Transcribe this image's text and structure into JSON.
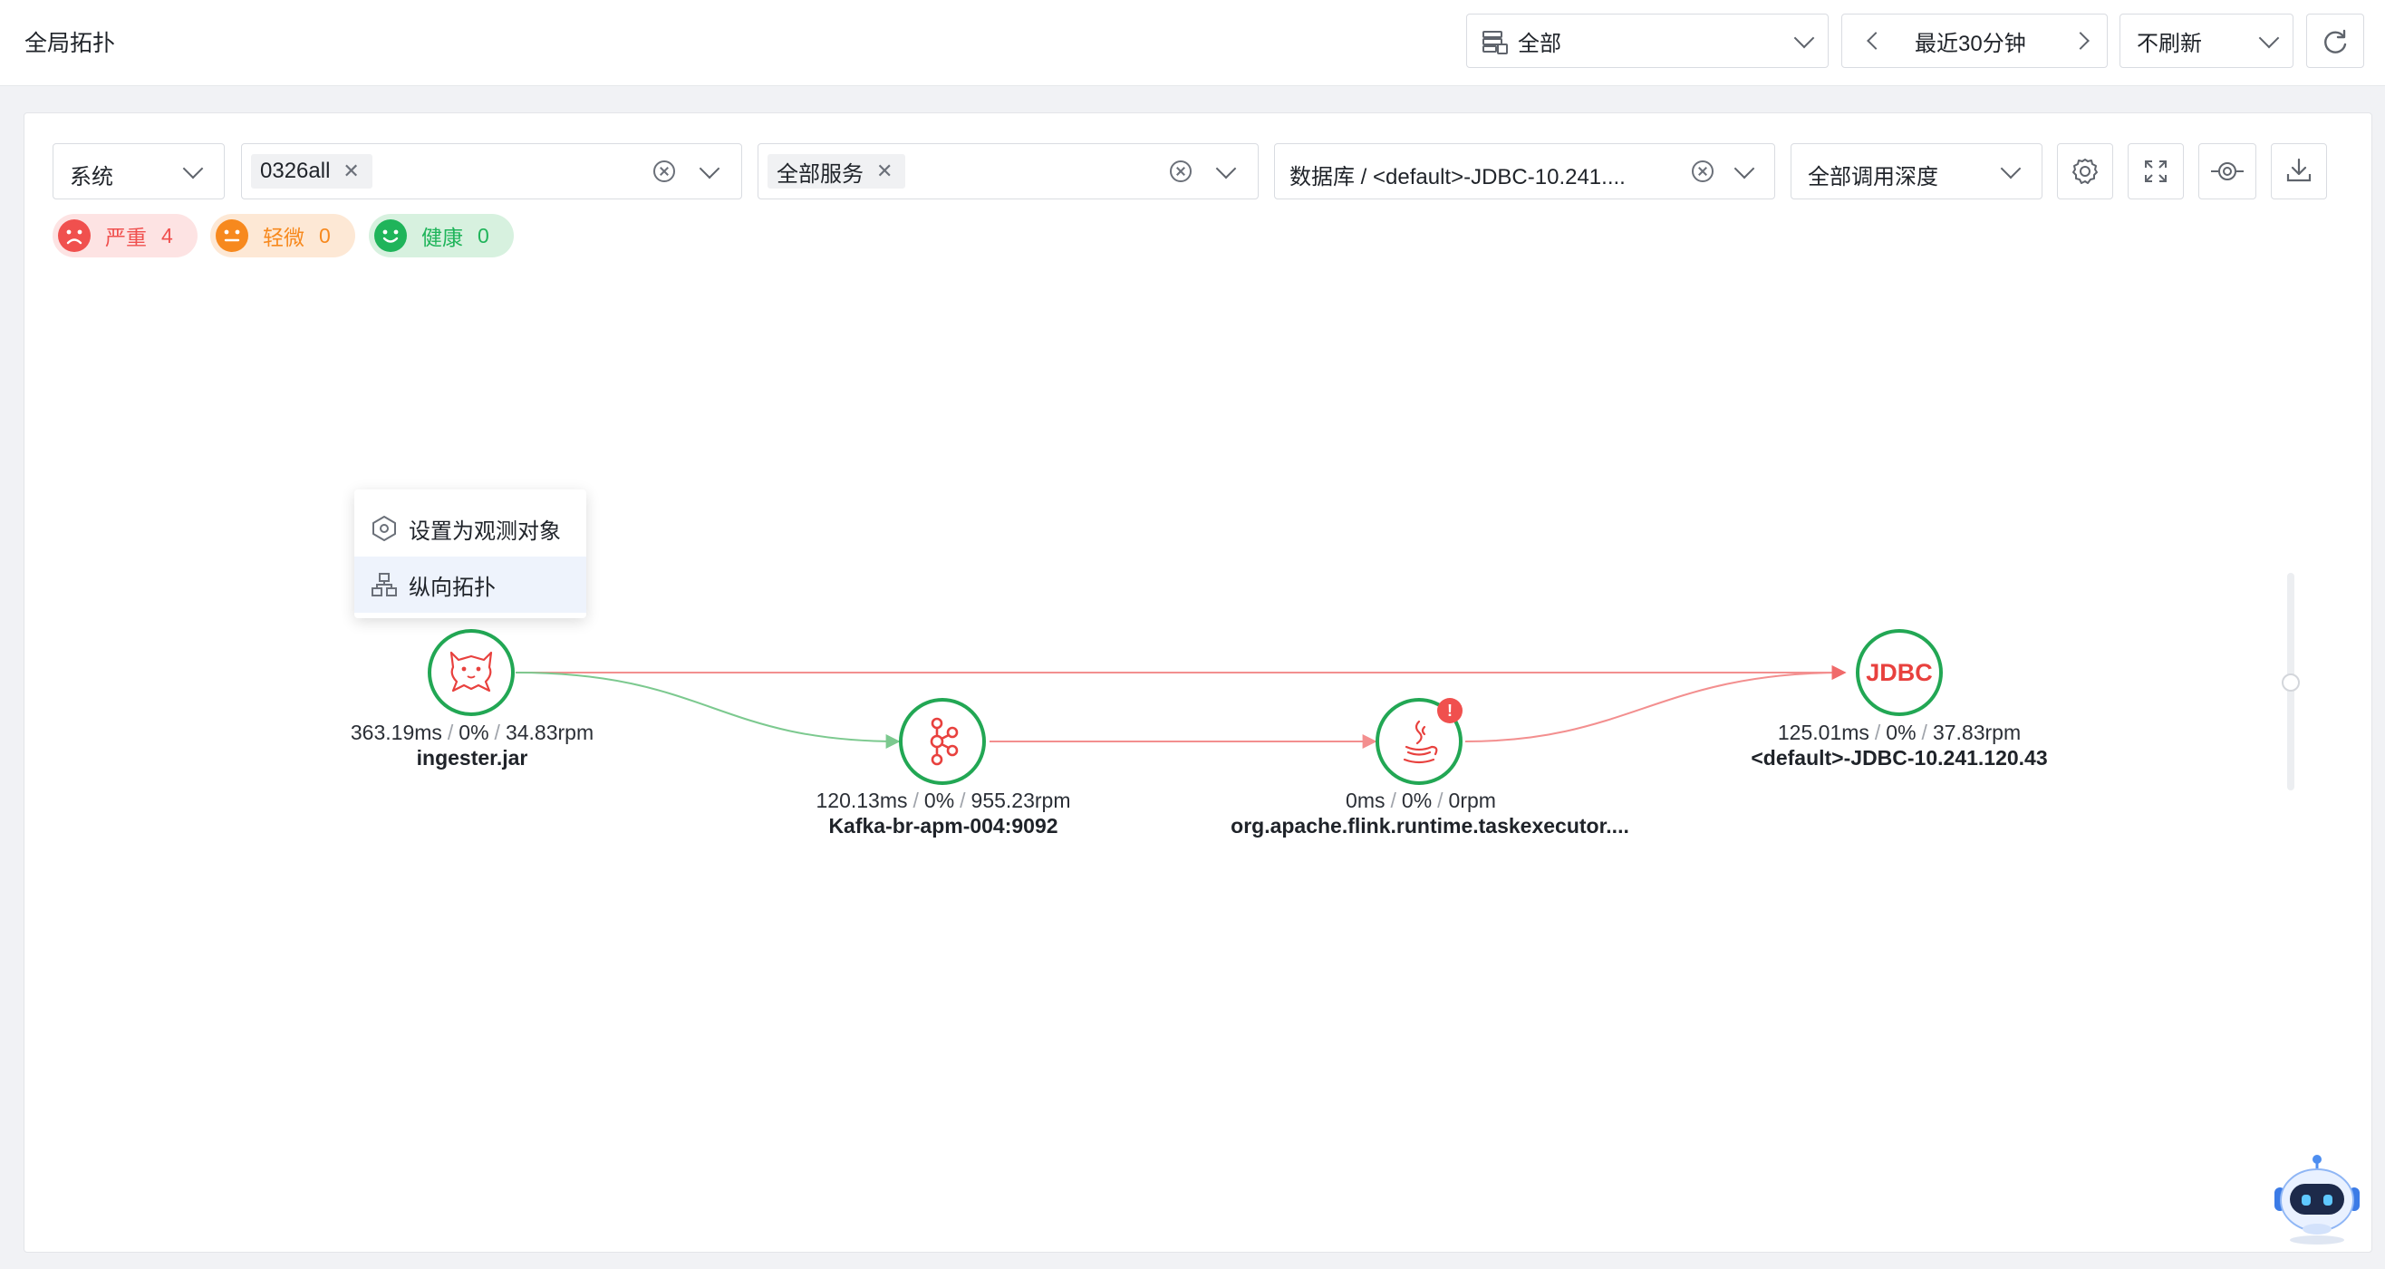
{
  "header": {
    "title": "全局拓扑",
    "scope_select": "全部",
    "time_range": "最近30分钟",
    "refresh_select": "不刷新"
  },
  "filters": {
    "type_select": "系统",
    "system_tag": "0326all",
    "service_tag": "全部服务",
    "database_select": "数据库 / <default>-JDBC-10.241....",
    "depth_select": "全部调用深度"
  },
  "status_badges": [
    {
      "label": "严重",
      "count": "4",
      "color": "#f0504e"
    },
    {
      "label": "轻微",
      "count": "0",
      "color": "#f7891e"
    },
    {
      "label": "健康",
      "count": "0",
      "color": "#1fb45a"
    }
  ],
  "context_menu": {
    "items": [
      {
        "label": "设置为观测对象",
        "icon": "observe-icon"
      },
      {
        "label": "纵向拓扑",
        "icon": "hierarchy-icon"
      }
    ]
  },
  "nodes": [
    {
      "id": "ingester",
      "name": "ingester.jar",
      "latency": "363.19ms",
      "error": "0%",
      "throughput": "34.83rpm",
      "icon": "tomcat-icon"
    },
    {
      "id": "kafka",
      "name": "Kafka-br-apm-004:9092",
      "latency": "120.13ms",
      "error": "0%",
      "throughput": "955.23rpm",
      "icon": "kafka-icon"
    },
    {
      "id": "flink",
      "name": "org.apache.flink.runtime.taskexecutor....",
      "latency": "0ms",
      "error": "0%",
      "throughput": "0rpm",
      "icon": "java-icon",
      "alert": "!"
    },
    {
      "id": "jdbc",
      "name": "<default>-JDBC-10.241.120.43",
      "latency": "125.01ms",
      "error": "0%",
      "throughput": "37.83rpm",
      "icon": "jdbc-icon",
      "label": "JDBC"
    }
  ],
  "colors": {
    "healthy_edge": "#7cc98f",
    "error_edge": "#f38f8f",
    "node_border": "#22a754",
    "critical": "#f0504e"
  }
}
